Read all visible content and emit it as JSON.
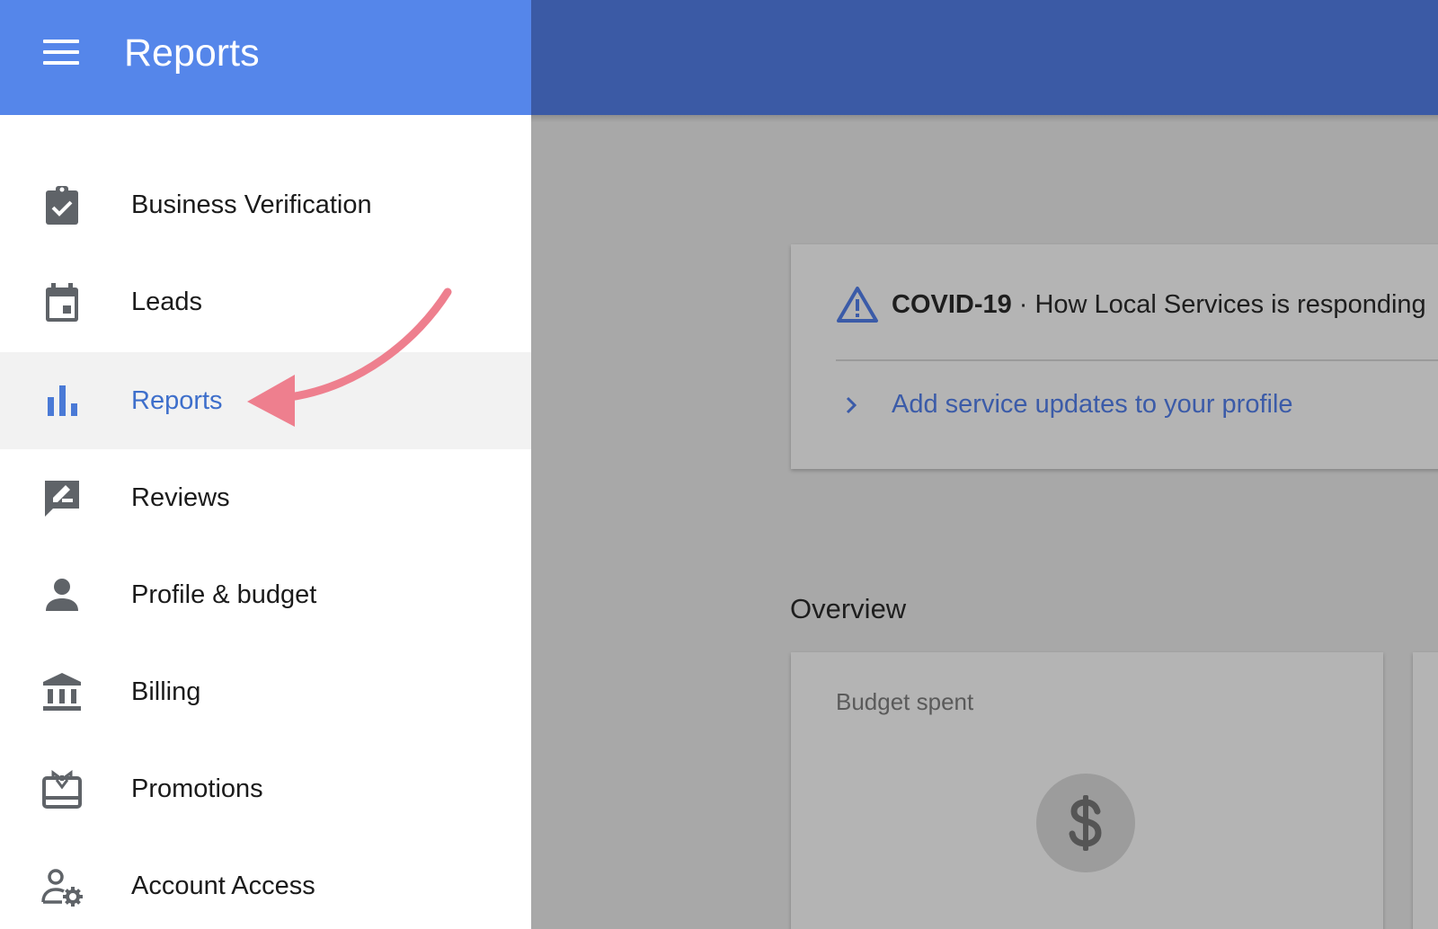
{
  "drawer": {
    "title": "Reports",
    "active_item": "Reports",
    "items": [
      {
        "label": "Business Verification",
        "icon": "clipboard-check-icon"
      },
      {
        "label": "Leads",
        "icon": "calendar-icon"
      },
      {
        "label": "Reports",
        "icon": "bar-chart-icon"
      },
      {
        "label": "Reviews",
        "icon": "rate-review-icon"
      },
      {
        "label": "Profile & budget",
        "icon": "person-icon"
      },
      {
        "label": "Billing",
        "icon": "bank-icon"
      },
      {
        "label": "Promotions",
        "icon": "gift-card-icon"
      },
      {
        "label": "Account Access",
        "icon": "person-gear-icon"
      }
    ]
  },
  "covid_card": {
    "title": "COVID-19",
    "separator": "·",
    "subtitle": "How Local Services is responding",
    "link_label": "Add service updates to your profile"
  },
  "overview": {
    "title": "Overview",
    "budget_card_label": "Budget spent"
  },
  "colors": {
    "drawer_header": "#5586ea",
    "main_header_dimmed": "#3b5aa5",
    "active_item_text": "#3e6fcb",
    "active_item_bg": "#f2f2f2",
    "annotation_arrow": "#ee7f8e",
    "overlay_bg": "#a8a8a8"
  }
}
